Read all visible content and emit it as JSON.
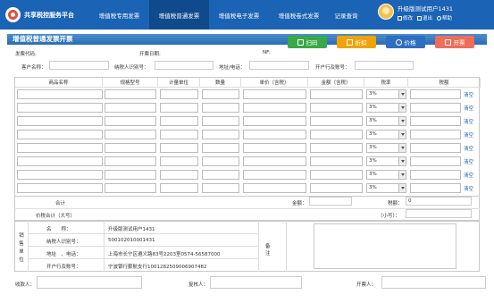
{
  "header": {
    "brand": "共享税控服务平台",
    "nav": [
      "增值税专用发票",
      "增值税普通发票",
      "增值税电子发票",
      "增值税卷式发票",
      "记录查询"
    ],
    "active_index": 1,
    "user_name": "升级版测试用户1431",
    "user_links": [
      "修改",
      "退出",
      "帮助"
    ]
  },
  "colors": {
    "header": "#1b63b4",
    "nav_active": "#0f4a8c",
    "btn_scan": "#39a846",
    "btn_discount": "#f0a30a",
    "btn_price": "#2f6fc1",
    "btn_issue": "#ef6d5a",
    "clear_link": "#1b63b4"
  },
  "page": {
    "title": "增值税普通发票开票"
  },
  "toolbar": {
    "scan": "扫码",
    "discount": "折扣",
    "price": "价格",
    "issue": "开票"
  },
  "invoice_meta": {
    "code_label": "发票代码:",
    "date_label": "开票日期:",
    "number_label": "NF:"
  },
  "buyer": {
    "name_label": "客户名称：",
    "tax_id_label": "纳税人识别号：",
    "address_label": "地址/电话：",
    "bank_label": "开户行及账号："
  },
  "table": {
    "headers": [
      "商品名称",
      "规格型号",
      "计量单位",
      "数量",
      "单价（含税）",
      "金额（含税）",
      "税率",
      "税额"
    ],
    "rows": [
      {
        "rate": "3%",
        "action": "清空"
      },
      {
        "rate": "3%",
        "action": "清空"
      },
      {
        "rate": "3%",
        "action": "清空"
      },
      {
        "rate": "3%",
        "action": "清空"
      },
      {
        "rate": "3%",
        "action": "清空"
      },
      {
        "rate": "3%",
        "action": "清空"
      },
      {
        "rate": "3%",
        "action": "清空"
      },
      {
        "rate": "3%",
        "action": "清空"
      }
    ]
  },
  "totals": {
    "total_label": "合计",
    "amount_label": "金额：",
    "tax_label": "税额：",
    "tax_value": "0",
    "grand_label": "价税合计（大写）",
    "grand_small_label": "（小写）："
  },
  "seller": {
    "section_label": "销售单位",
    "name_label": "名　　称：",
    "name_value": "升级版测试用户1431",
    "tax_id_label": "纳税人识别号：",
    "tax_id_value": "500102010001431",
    "address_label": "地址　、电话：",
    "address_value": "上海市长宁区遵义路83号2203室0574-56587000",
    "bank_label": "开户行及账号：",
    "bank_value": "宁波银行鄞航支行1001282509006907482",
    "remark_label": "备注"
  },
  "signers": {
    "payee": "收款人：",
    "reviewer": "复核人：",
    "drawer": "开票人："
  }
}
